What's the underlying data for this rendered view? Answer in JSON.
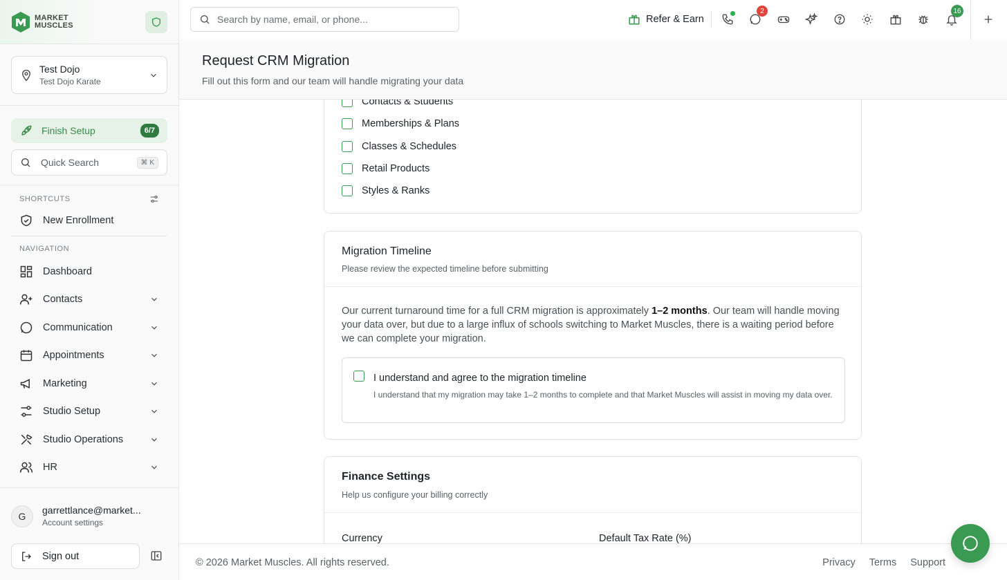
{
  "brand": {
    "line1": "MARKET",
    "line2": "MUSCLES"
  },
  "location": {
    "name": "Test Dojo",
    "sub": "Test Dojo Karate"
  },
  "finish_setup": {
    "label": "Finish Setup",
    "badge": "6/7"
  },
  "quick_search": {
    "label": "Quick Search",
    "shortcut": "⌘ K"
  },
  "shortcuts": {
    "heading": "SHORTCUTS",
    "items": [
      {
        "label": "New Enrollment"
      }
    ]
  },
  "navigation": {
    "heading": "NAVIGATION",
    "items": [
      {
        "label": "Dashboard"
      },
      {
        "label": "Contacts"
      },
      {
        "label": "Communication"
      },
      {
        "label": "Appointments"
      },
      {
        "label": "Marketing"
      },
      {
        "label": "Studio Setup"
      },
      {
        "label": "Studio Operations"
      },
      {
        "label": "HR"
      }
    ]
  },
  "account": {
    "initial": "G",
    "email": "garrettlance@market...",
    "sub": "Account settings"
  },
  "sign_out": "Sign out",
  "topbar": {
    "search_placeholder": "Search by name, email, or phone...",
    "refer_label": "Refer & Earn",
    "messages_badge": "2",
    "notifications_badge": "16"
  },
  "page": {
    "title": "Request CRM Migration",
    "subtitle": "Fill out this form and our team will handle migrating your data"
  },
  "data_types": [
    {
      "label": "Contacts & Students"
    },
    {
      "label": "Memberships & Plans"
    },
    {
      "label": "Classes & Schedules"
    },
    {
      "label": "Retail Products"
    },
    {
      "label": "Styles & Ranks"
    }
  ],
  "timeline": {
    "title": "Migration Timeline",
    "subtitle": "Please review the expected timeline before submitting",
    "text_before": "Our current turnaround time for a full CRM migration is approximately ",
    "text_bold": "1–2 months",
    "text_after": ". Our team will handle moving your data over, but due to a large influx of schools switching to Market Muscles, there is a waiting period before we can complete your migration.",
    "agree_title": "I understand and agree to the migration timeline",
    "agree_desc": "I understand that my migration may take 1–2 months to complete and that Market Muscles will assist in moving my data over."
  },
  "finance": {
    "title": "Finance Settings",
    "subtitle": "Help us configure your billing correctly",
    "currency_label": "Currency",
    "tax_label": "Default Tax Rate (%)"
  },
  "footer": {
    "copyright": "© 2026 Market Muscles. All rights reserved.",
    "links": [
      {
        "label": "Privacy"
      },
      {
        "label": "Terms"
      },
      {
        "label": "Support"
      }
    ]
  },
  "colors": {
    "brand_green": "#3a9a52",
    "badge_red": "#e0443a"
  }
}
